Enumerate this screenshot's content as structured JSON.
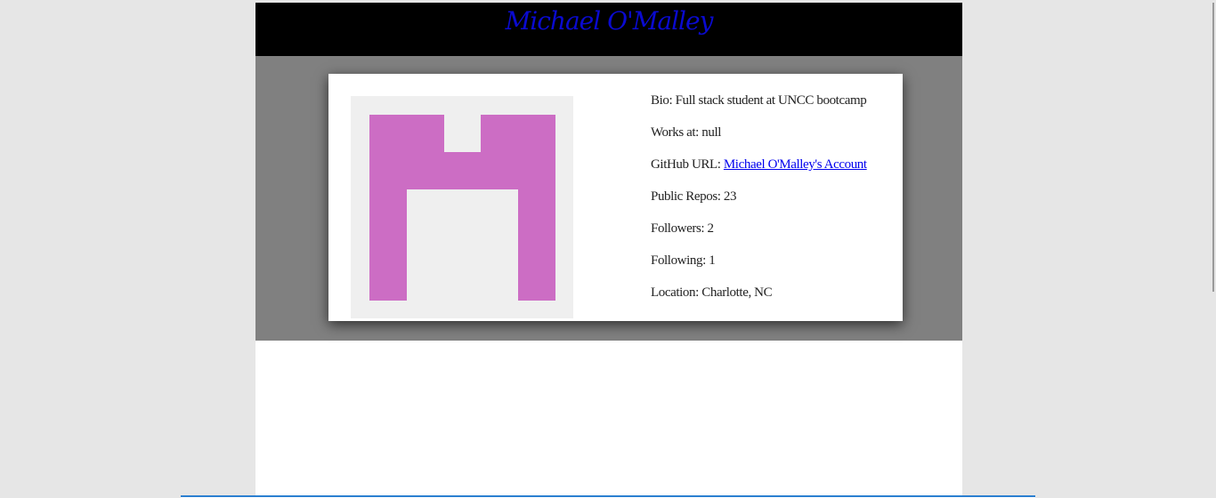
{
  "header": {
    "title": "Michael O'Malley"
  },
  "profile": {
    "avatar_icon": "identicon-m-icon",
    "avatar_color": "#cc6dc4",
    "bio_label": "Bio: ",
    "bio_value": "Full stack student at UNCC bootcamp",
    "works_label": "Works at: ",
    "works_value": "null",
    "github_label": "GitHub URL: ",
    "github_link": "Michael O'Malley's Account",
    "repos_label": "Public Repos: ",
    "repos_value": "23",
    "followers_label": "Followers: ",
    "followers_value": "2",
    "following_label": "Following: ",
    "following_value": "1",
    "location_label": "Location: ",
    "location_value": "Charlotte, NC"
  },
  "colors": {
    "header_bg": "#000000",
    "title_color": "#0a0ad0",
    "band_bg": "#808080",
    "link_color": "#0000ee"
  }
}
